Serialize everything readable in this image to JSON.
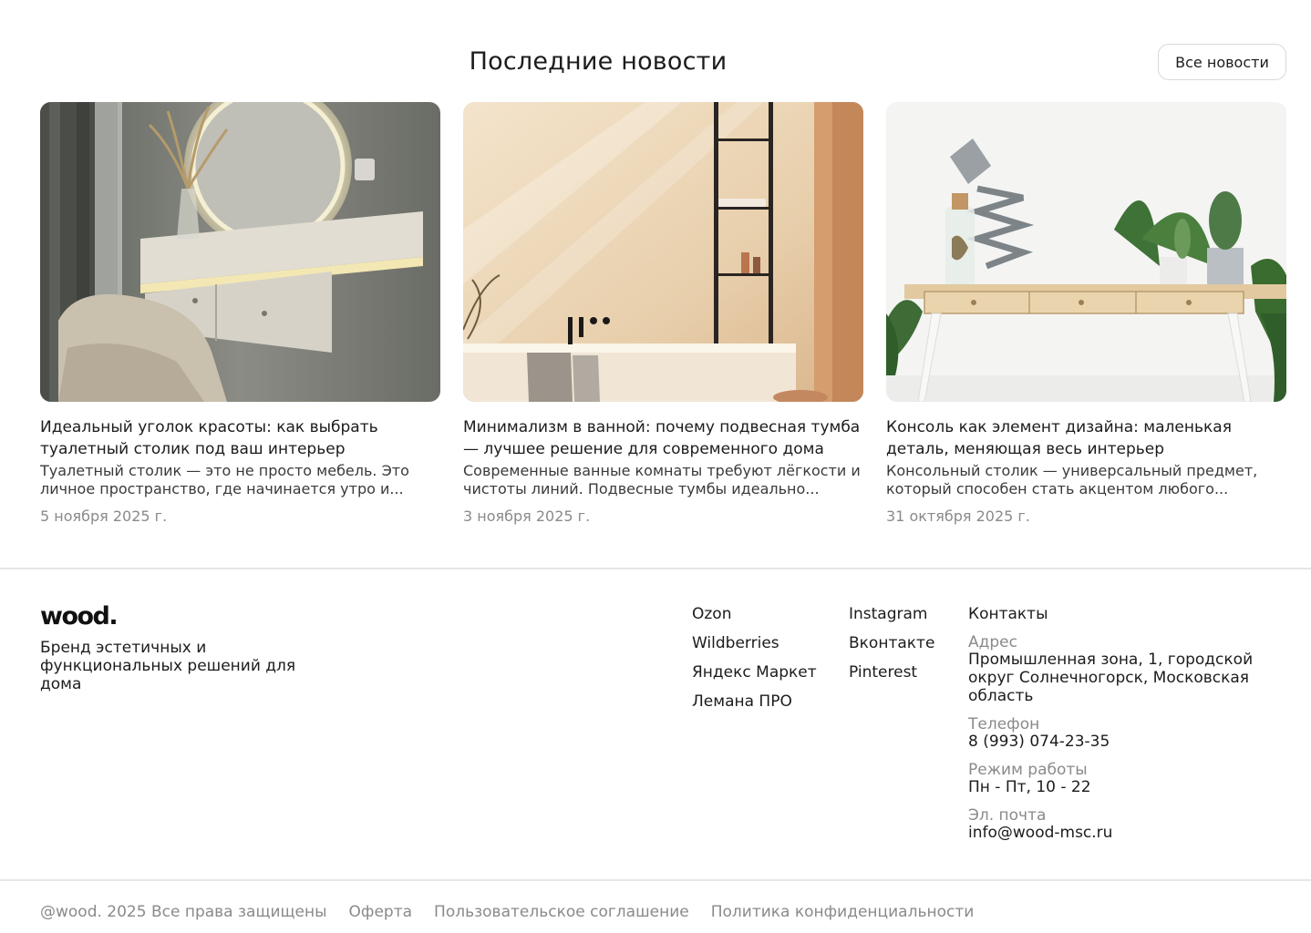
{
  "news": {
    "title": "Последние новости",
    "all_news_label": "Все новости",
    "cards": [
      {
        "title": "Идеальный уголок красоты: как выбрать туалетный столик под ваш интерьер",
        "excerpt": "Туалетный столик — это не просто мебель. Это личное пространство, где начинается утро и...",
        "date": "5 ноября 2025 г."
      },
      {
        "title": "Минимализм в ванной: почему подвесная тумба — лучшее решение для современного дома",
        "excerpt": "Современные ванные комнаты требуют лёгкости и чистоты линий. Подвесные тумбы идеально...",
        "date": "3 ноября 2025 г."
      },
      {
        "title": "Консоль как элемент дизайна: маленькая деталь, меняющая весь интерьер",
        "excerpt": "Консольный столик — универсальный предмет, который способен стать акцентом любого...",
        "date": "31 октября 2025 г."
      }
    ]
  },
  "footer": {
    "logo": "wood.",
    "tagline": "Бренд эстетичных и функциональных решений для дома",
    "shops": [
      "Ozon",
      "Wildberries",
      "Яндекс Маркет",
      "Лемана ПРО"
    ],
    "social": [
      "Instagram",
      "Вконтакте",
      "Pinterest"
    ],
    "contacts": {
      "title": "Контакты",
      "address_label": "Адрес",
      "address": "Промышленная зона, 1, городской округ Солнечногорск, Московская область",
      "phone_label": "Телефон",
      "phone": "8 (993) 074-23-35",
      "hours_label": "Режим работы",
      "hours": "Пн - Пт, 10 - 22",
      "email_label": "Эл. почта",
      "email": "info@wood-msc.ru"
    },
    "bottom": {
      "copyright": "@wood. 2025 Все права защищены",
      "offer": "Оферта",
      "agreement": "Пользовательское соглашение",
      "privacy": "Политика конфиденциальности"
    }
  }
}
